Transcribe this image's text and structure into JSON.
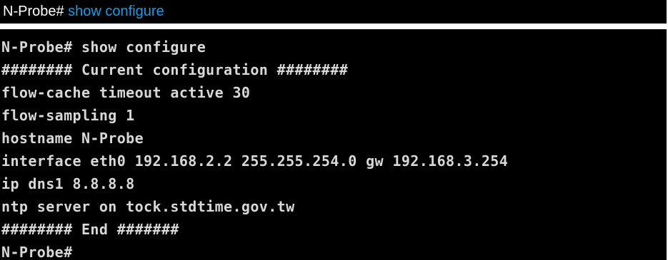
{
  "header": {
    "prompt": "N-Probe#",
    "command": "show configure"
  },
  "terminal": {
    "lines": [
      "N-Probe# show configure",
      "######## Current configuration ########",
      "flow-cache timeout active 30",
      "flow-sampling 1",
      "hostname N-Probe",
      "interface eth0 192.168.2.2 255.255.254.0 gw 192.168.3.254",
      "ip dns1 8.8.8.8",
      "ntp server on tock.stdtime.gov.tw",
      "######## End #######",
      "N-Probe#"
    ]
  },
  "colors": {
    "background": "#000000",
    "terminal_text": "#d8d8d8",
    "header_text": "#ffffff",
    "command_accent": "#1e9be6"
  }
}
